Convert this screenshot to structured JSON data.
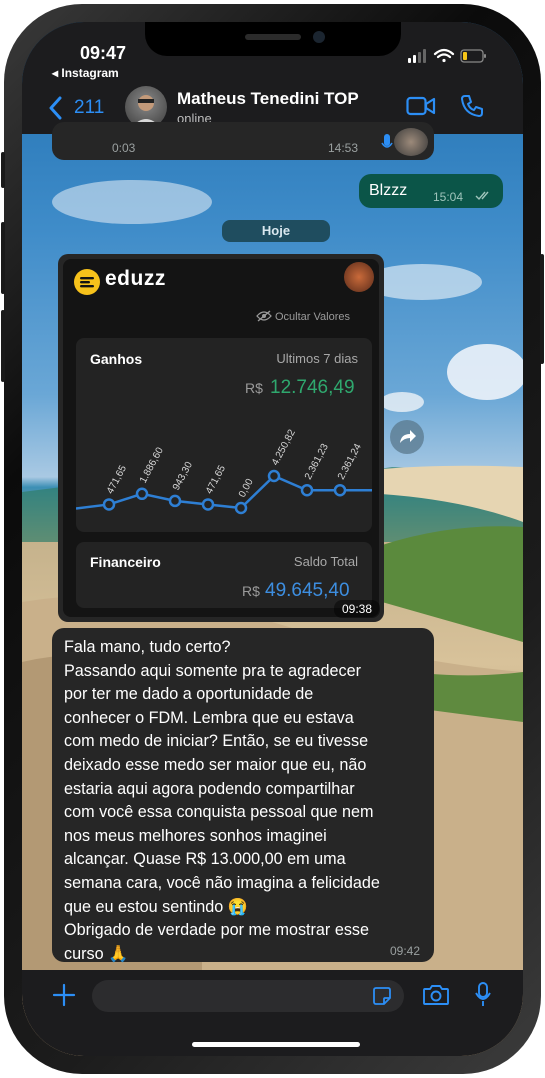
{
  "status_bar": {
    "time": "09:47",
    "back_app": "◂ Instagram"
  },
  "header": {
    "back_count": "211",
    "contact_name": "Matheus Tenedini TOP",
    "contact_status": "online",
    "back_icon": "chevron-left-icon",
    "video_icon": "video-call-icon",
    "phone_icon": "phone-icon"
  },
  "audio_message": {
    "elapsed": "0:03",
    "time": "14:53"
  },
  "sent_message": {
    "text": "Blzzz",
    "time": "15:04"
  },
  "date_separator": "Hoje",
  "image_message": {
    "time": "09:38",
    "brand": "eduzz",
    "hide_values": "Ocultar Valores",
    "earnings": {
      "title": "Ganhos",
      "period": "Ultimos 7 dias",
      "currency": "R$",
      "value": "12.746,49",
      "color": "#2fa86e"
    },
    "finance": {
      "title": "Financeiro",
      "subtitle": "Saldo Total",
      "currency": "R$",
      "value": "49.645,40",
      "color": "#3d8ee0"
    }
  },
  "chart_data": {
    "type": "line",
    "x": [
      "1",
      "2",
      "3",
      "4",
      "5",
      "6",
      "7",
      "8"
    ],
    "series": [
      {
        "values": [
          471.65,
          1886.6,
          943.3,
          471.65,
          0,
          4250.82,
          2361.23,
          2361.24
        ]
      }
    ],
    "data_labels": [
      "471,65",
      "1.886,60",
      "943,30",
      "471,65",
      "0,00",
      "4.250,82",
      "2.361,23",
      "2.361,24"
    ],
    "xlabel": "",
    "ylabel": "",
    "grid": false,
    "color": "#2e7fd4"
  },
  "text_message": {
    "lines": [
      "Fala mano, tudo certo?",
      "Passando aqui somente pra te agradecer",
      "por ter me dado a oportunidade de",
      "conhecer o FDM. Lembra que eu estava",
      "com medo de iniciar? Então, se eu tivesse",
      "deixado esse medo ser maior que eu, não",
      "estaria aqui agora podendo compartilhar",
      "com você essa conquista pessoal que nem",
      "nos meus melhores sonhos imaginei",
      "alcançar. Quase R$ 13.000,00 em uma",
      "semana cara, você não imagina a felicidade",
      "que eu estou sentindo 😭",
      "Obrigado de verdade por me mostrar esse",
      "curso 🙏"
    ],
    "time": "09:42"
  },
  "input_bar": {
    "plus_icon": "plus-icon",
    "sticker_icon": "sticker-icon",
    "camera_icon": "camera-icon",
    "mic_icon": "microphone-icon",
    "accent": "#2c8ef5"
  }
}
